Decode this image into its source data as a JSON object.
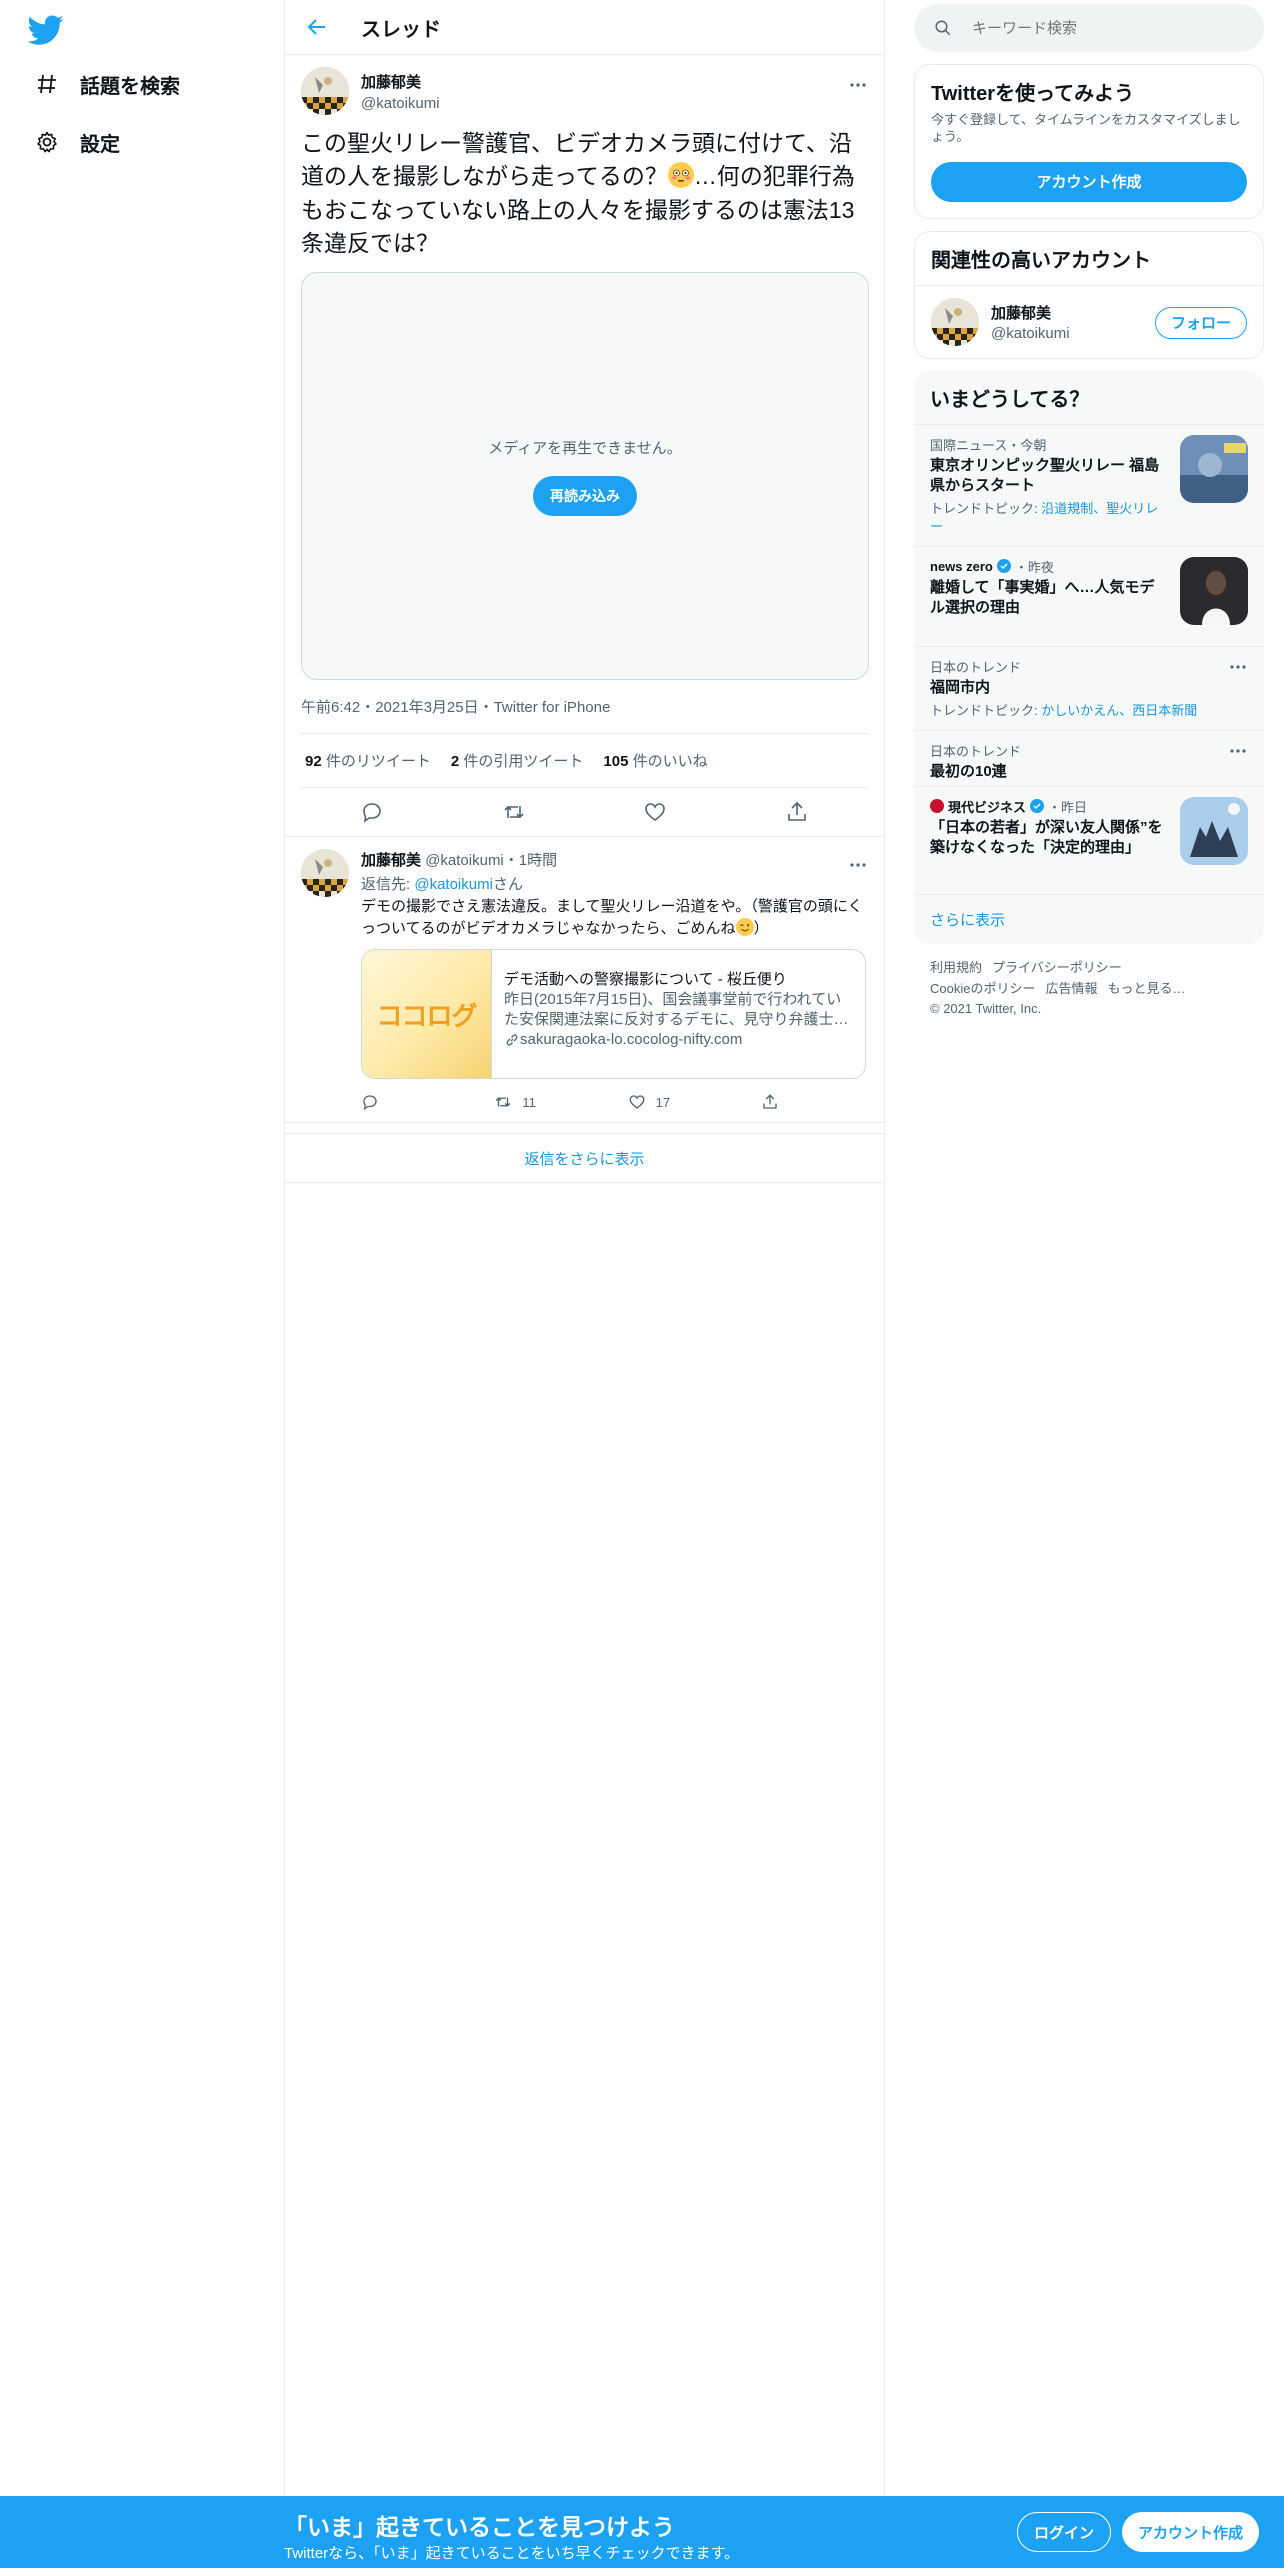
{
  "colors": {
    "accent": "#1da1f2",
    "link": "#1b95e0",
    "text": "#0f1419",
    "muted": "#536471",
    "border": "#e6ecf0"
  },
  "nav": {
    "logo_icon": "twitter-bird-icon",
    "items": [
      {
        "icon": "hashtag-icon",
        "label": "話題を検索"
      },
      {
        "icon": "gear-icon",
        "label": "設定"
      }
    ]
  },
  "header": {
    "title": "スレッド",
    "back_icon": "back-arrow-icon"
  },
  "tweet": {
    "author_name": "加藤郁美",
    "author_handle": "@katoikumi",
    "text_part1": "この聖火リレー警護官、ビデオカメラ頭に付けて、沿道の人を撮影しながら走ってるの？",
    "emoji": "flushed-face-emoji",
    "text_part2": "…何の犯罪行為もおこなっていない路上の人々を撮影するのは憲法13条違反では？",
    "media_message": "メディアを再生できません。",
    "reload_label": "再読み込み",
    "meta": "午前6:42・2021年3月25日・Twitter for iPhone",
    "retweets_count": "92",
    "retweets_label": "件のリツイート",
    "quotes_count": "2",
    "quotes_label": "件の引用ツイート",
    "likes_count": "105",
    "likes_label": "件のいいね"
  },
  "reply": {
    "author_name": "加藤郁美",
    "author_handle": "@katoikumi",
    "time": "・1時間",
    "replying_prefix": "返信先: ",
    "replying_handle": "@katoikumi",
    "replying_suffix": "さん",
    "text": "デモの撮影でさえ憲法違反。まして聖火リレー沿道をや。（警護官の頭にくっついてるのがビデオカメラじゃなかったら、ごめんね",
    "text_end": "）",
    "card": {
      "thumb_text": "ココログ",
      "title": "デモ活動への警察撮影について - 桜丘便り",
      "description": "昨日(2015年7月15日)、国会議事堂前で行われていた安保関連法案に反対するデモに、見守り弁護士…",
      "url": "sakuragaoka-lo.cocolog-nifty.com"
    },
    "retweets": "11",
    "likes": "17"
  },
  "show_more_replies": "返信をさらに表示",
  "search": {
    "placeholder": "キーワード検索"
  },
  "signup_panel": {
    "title": "Twitterを使ってみよう",
    "description": "今すぐ登録して、タイムラインをカスタマイズしましょう。",
    "button": "アカウント作成"
  },
  "related": {
    "title": "関連性の高いアカウント",
    "name": "加藤郁美",
    "handle": "@katoikumi",
    "follow_label": "フォロー"
  },
  "trends": {
    "title": "いまどうしてる？",
    "items": [
      {
        "context": "国際ニュース・今朝",
        "title": "東京オリンピック聖火リレー 福島県からスタート",
        "sub_prefix": "トレンドトピック: ",
        "sub_links": "沿道規制、聖火リレー"
      },
      {
        "source": "news zero",
        "time": "・昨夜",
        "title": "離婚して「事実婚」へ…人気モデル選択の理由"
      },
      {
        "context": "日本のトレンド",
        "title": "福岡市内",
        "sub_prefix": "トレンドトピック: ",
        "sub_links": "かしいかえん、西日本新聞"
      },
      {
        "context": "日本のトレンド",
        "title": "最初の10連"
      },
      {
        "source": "現代ビジネス",
        "time": "・昨日",
        "title": "「日本の若者」が深い友人関係”を築けなくなった「決定的理由」"
      }
    ],
    "show_more": "さらに表示"
  },
  "footer": {
    "links1": [
      "利用規約",
      "プライバシーポリシー"
    ],
    "links2": [
      "Cookieのポリシー",
      "広告情報",
      "もっと見る…"
    ],
    "copyright": "© 2021 Twitter, Inc."
  },
  "bottom_bar": {
    "title": "「いま」起きていることを見つけよう",
    "subtitle": "Twitterなら、「いま」起きていることをいち早くチェックできます。",
    "login": "ログイン",
    "signup": "アカウント作成"
  }
}
